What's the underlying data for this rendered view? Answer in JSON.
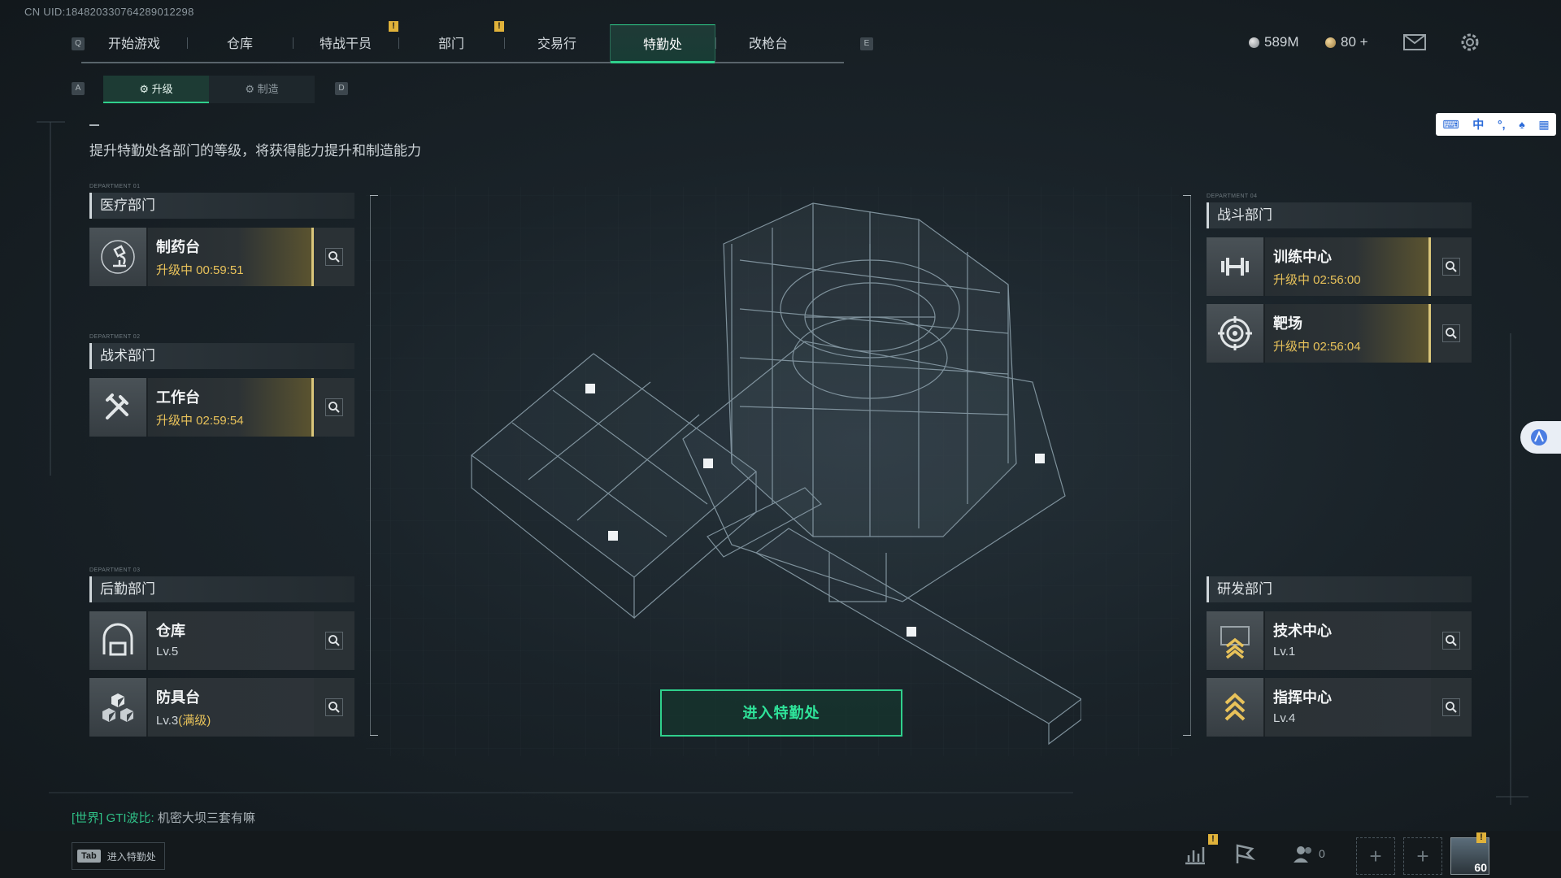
{
  "uid": "CN UID:184820330764289012298",
  "nav": {
    "left_key": "Q",
    "right_key": "E",
    "items": [
      {
        "label": "开始游戏",
        "badge": ""
      },
      {
        "label": "仓库",
        "badge": ""
      },
      {
        "label": "特战干员",
        "badge": "!"
      },
      {
        "label": "部门",
        "badge": "!"
      },
      {
        "label": "交易行",
        "badge": ""
      },
      {
        "label": "特勤处",
        "badge": ""
      },
      {
        "label": "改枪台",
        "badge": ""
      }
    ],
    "active_index": 5
  },
  "currency": {
    "silver": "589M",
    "gold": "80 +"
  },
  "subtabs": {
    "left_key": "A",
    "right_key": "D",
    "upgrade": "升级",
    "craft": "制造"
  },
  "description": "提升特勤处各部门的等级，将获得能力提升和制造能力",
  "departments": {
    "medical": {
      "tag": "DEPARTMENT 01",
      "title": "医疗部门",
      "cards": [
        {
          "name": "制药台",
          "status": "升级中 00:59:51"
        }
      ]
    },
    "tactical": {
      "tag": "DEPARTMENT 02",
      "title": "战术部门",
      "cards": [
        {
          "name": "工作台",
          "status": "升级中 02:59:54"
        }
      ]
    },
    "logistics": {
      "tag": "DEPARTMENT 03",
      "title": "后勤部门",
      "cards": [
        {
          "name": "仓库",
          "status": "Lv.5"
        },
        {
          "name": "防具台",
          "status": "Lv.3",
          "status_extra": "(满级)"
        }
      ]
    },
    "combat": {
      "tag": "DEPARTMENT 04",
      "title": "战斗部门",
      "cards": [
        {
          "name": "训练中心",
          "status": "升级中 02:56:00"
        },
        {
          "name": "靶场",
          "status": "升级中 02:56:04"
        }
      ]
    },
    "research": {
      "title": "研发部门",
      "cards": [
        {
          "name": "技术中心",
          "status": "Lv.1"
        },
        {
          "name": "指挥中心",
          "status": "Lv.4"
        }
      ]
    }
  },
  "enter_button": "进入特勤处",
  "chat": {
    "channel": "[世界]",
    "user": "GTI波比:",
    "message": "机密大坝三套有嘛"
  },
  "tab_hint": {
    "key": "Tab",
    "label": "进入特勤处"
  },
  "bottom": {
    "friends_count": "0",
    "level": "60",
    "badge": "!"
  },
  "ime": {
    "zh": "中"
  },
  "colors": {
    "accent": "#2fd08c",
    "timer": "#e8c25a",
    "badge": "#e0b23a"
  }
}
